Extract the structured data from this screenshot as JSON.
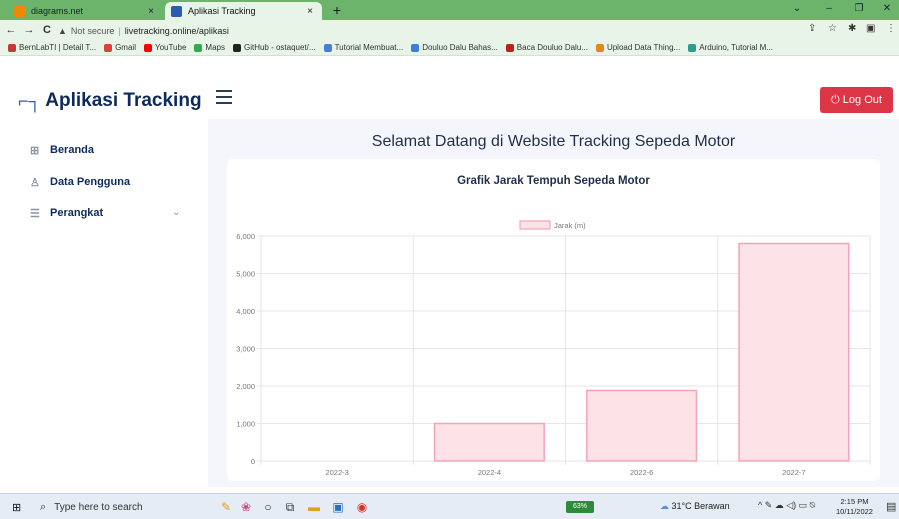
{
  "browser": {
    "tabs": [
      {
        "title": "diagrams.net",
        "close": "×"
      },
      {
        "title": "Aplikasi Tracking",
        "close": "×"
      }
    ],
    "new_tab": "+",
    "window_controls": [
      "⌄",
      "–",
      "❐",
      "✕"
    ],
    "nav": {
      "back": "←",
      "forward": "→",
      "reload": "C"
    },
    "security_label": "Not secure",
    "url": "livetracking.online/aplikasi",
    "bookmarks": [
      {
        "label": "BernLabTI | Detail T...",
        "color": "#c23b3b"
      },
      {
        "label": "Gmail",
        "color": "#d44638"
      },
      {
        "label": "YouTube",
        "color": "#ff0000"
      },
      {
        "label": "Maps",
        "color": "#34a853"
      },
      {
        "label": "GitHub - ostaquet/...",
        "color": "#222222"
      },
      {
        "label": "Tutorial Membuat...",
        "color": "#4a7dd6"
      },
      {
        "label": "Douluo Dalu Bahas...",
        "color": "#3b7fd9"
      },
      {
        "label": "Baca Douluo Dalu...",
        "color": "#b3261e"
      },
      {
        "label": "Upload Data Thing...",
        "color": "#e08a1e"
      },
      {
        "label": "Arduino, Tutorial M...",
        "color": "#2a9d8f"
      }
    ]
  },
  "app": {
    "logo_mark": "L̅",
    "title": "Aplikasi Tracking",
    "logout_label": "⏻ Log Out"
  },
  "sidebar": {
    "items": [
      {
        "label": "Beranda",
        "icon": "grid-icon",
        "glyph": "⊞"
      },
      {
        "label": "Data Pengguna",
        "icon": "user-icon",
        "glyph": "♙"
      },
      {
        "label": "Perangkat",
        "icon": "list-icon",
        "glyph": "☰"
      }
    ],
    "chevron": "⌄"
  },
  "main": {
    "page_title": "Selamat Datang di Website Tracking Sepeda Motor",
    "chart_title": "Grafik Jarak Tempuh Sepeda Motor"
  },
  "chart_data": {
    "type": "bar",
    "title": "Grafik Jarak Tempuh Sepeda Motor",
    "categories": [
      "2022-3",
      "2022-4",
      "2022-6",
      "2022-7"
    ],
    "series": [
      {
        "name": "Jarak (m)",
        "values": [
          0,
          1000,
          1880,
          5800
        ],
        "fill": "#fde3e8",
        "stroke": "#f5a3b5"
      }
    ],
    "ylim": [
      0,
      6000
    ],
    "yticks": [
      0,
      1000,
      2000,
      3000,
      4000,
      5000,
      6000
    ],
    "ytick_labels": [
      "0",
      "1,000",
      "2,000",
      "3,000",
      "4,000",
      "5,000",
      "6,000"
    ],
    "grid": true,
    "legend": "top-center"
  },
  "taskbar": {
    "search_placeholder": "Type here to search",
    "battery": "63%",
    "weather": "31°C  Berawan",
    "time": "2:15 PM",
    "date": "10/11/2022"
  }
}
